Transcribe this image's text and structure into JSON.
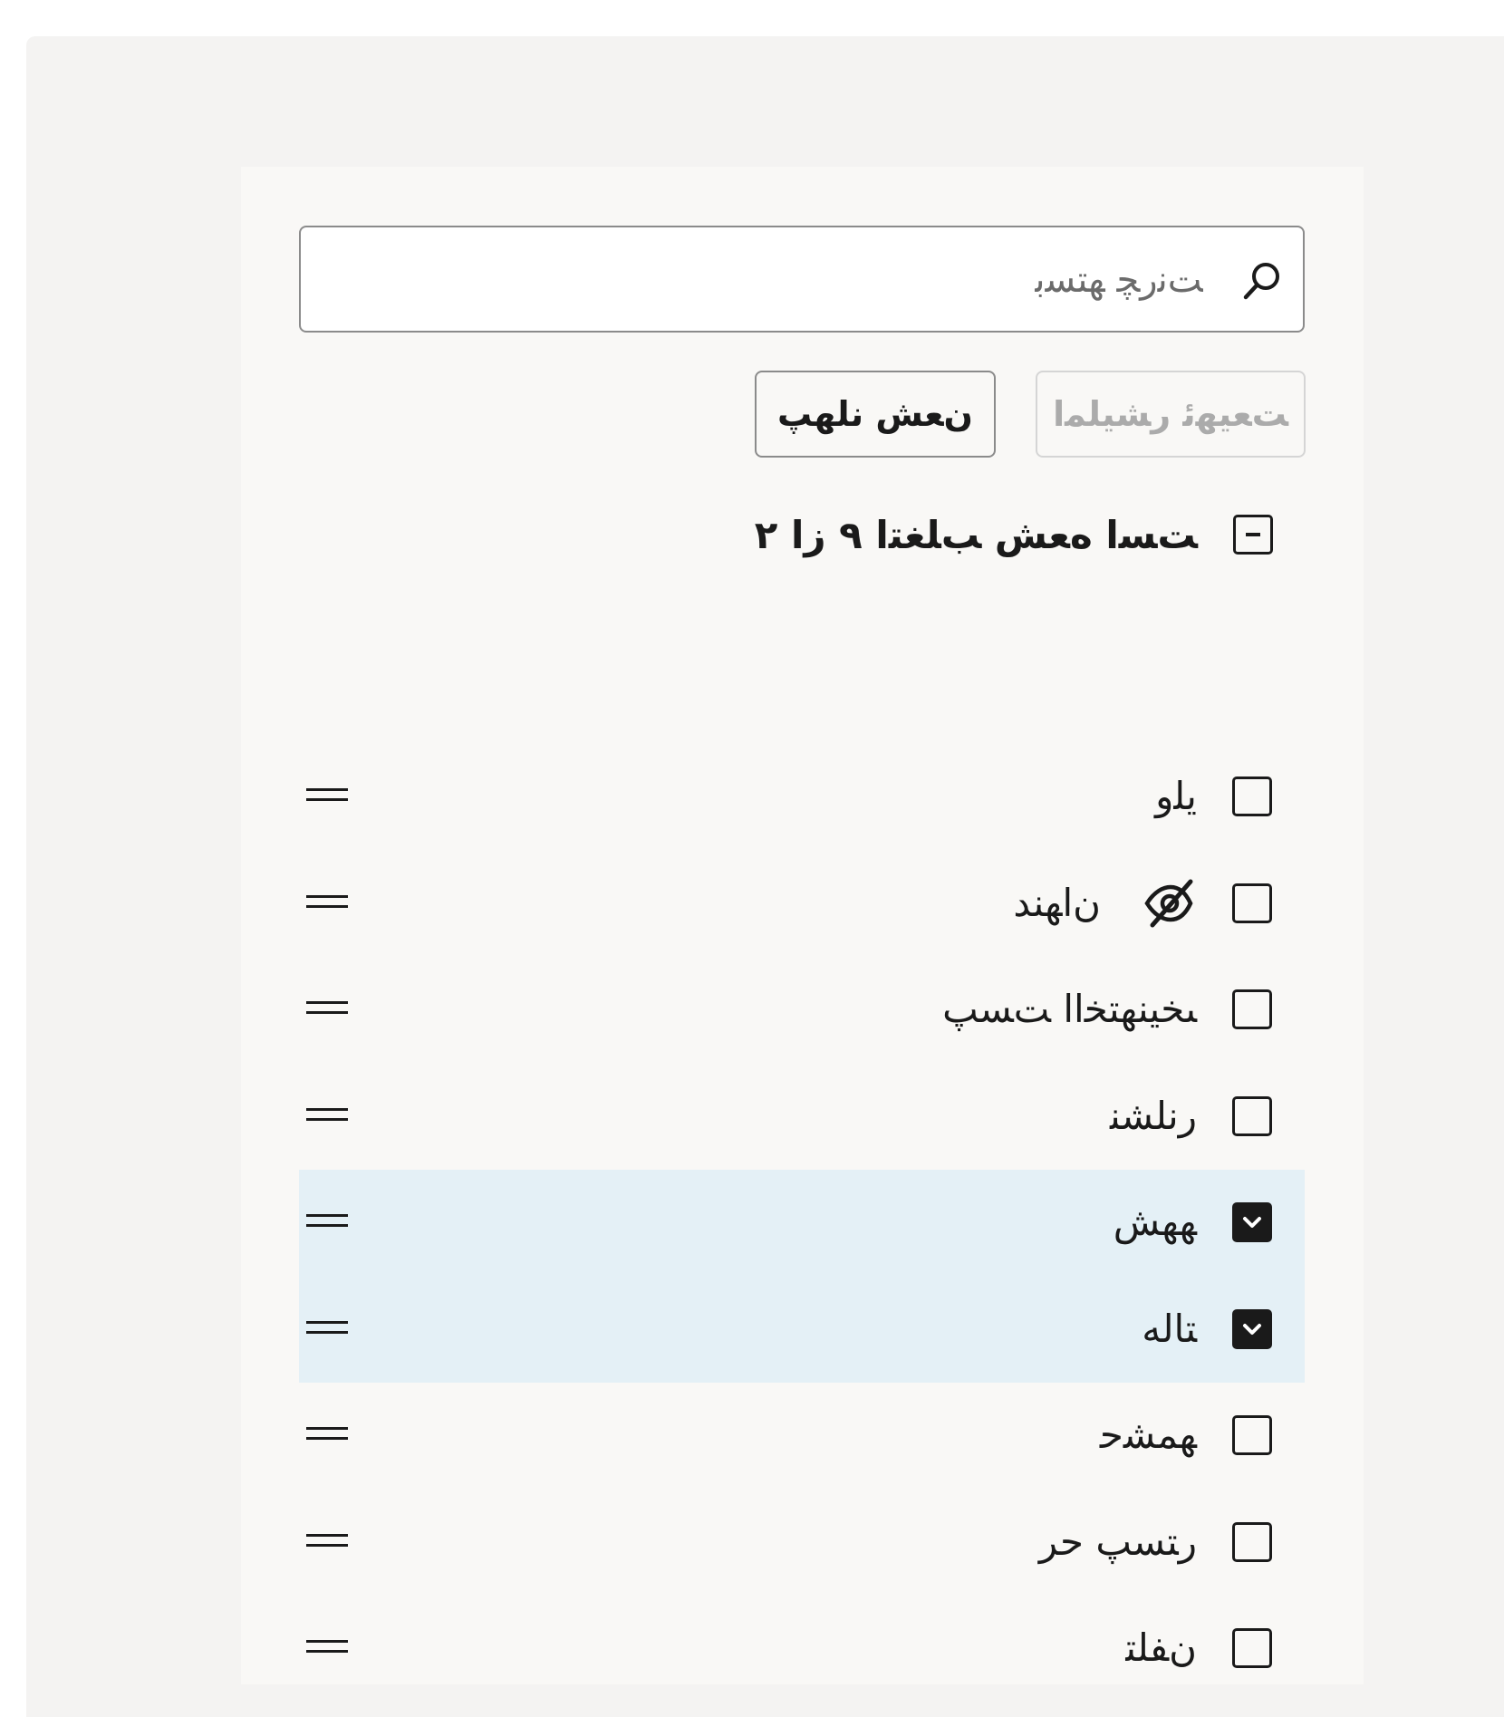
{
  "search": {
    "placeholder": "ﺖﻧﺭﭽ ﻬﺘﺴﺑ",
    "value": ""
  },
  "buttons": {
    "disabled_label": "ﺖﻌﻴﻬﺋ ﺭﺸﻴﻠﻤﺍ",
    "primary_label": "ﻥﻌﺶ ﻧﻠﻬﭗ"
  },
  "select_all": {
    "label": "ﺖﺴﺍ ﻩﻌﺶ ﺐﻠﻐﺘﺍ ۹ ﺯﺍ ۲",
    "state": "indeterminate"
  },
  "items": [
    {
      "label": "ﻳﻠﻭ",
      "checked": false,
      "hidden": false
    },
    {
      "label": "ﻥﺍﻬﻨﺪ",
      "checked": false,
      "hidden": true
    },
    {
      "label": "ﯩﺨﻴﻨﻬﺘﺨﺍﺍ ﺖﺴﭗ",
      "checked": false,
      "hidden": false
    },
    {
      "label": "ﺭﻧﻠﺸﻨ",
      "checked": false,
      "hidden": false
    },
    {
      "label": "ﻬﻬﺶ",
      "checked": true,
      "hidden": false
    },
    {
      "label": "ﺘﺎﻟﻪ",
      "checked": true,
      "hidden": false
    },
    {
      "label": "ﻬﻤﺸﺣ",
      "checked": false,
      "hidden": false
    },
    {
      "label": "ﺭﺘﺴﭗ ﺣﺮ",
      "checked": false,
      "hidden": false
    },
    {
      "label": "ﻥﻔﻠﺘ",
      "checked": false,
      "hidden": false
    }
  ],
  "colors": {
    "outer_bg": "#f4f3f2",
    "panel_bg": "#f9f8f6",
    "selected_row_bg": "#e4f0f6",
    "ink": "#1a1a1a"
  },
  "icons": {
    "search": "search-icon",
    "hidden": "eye-off-icon",
    "drag": "drag-handle-icon",
    "checkmark": "check-icon",
    "indeterminate": "minus-icon"
  }
}
